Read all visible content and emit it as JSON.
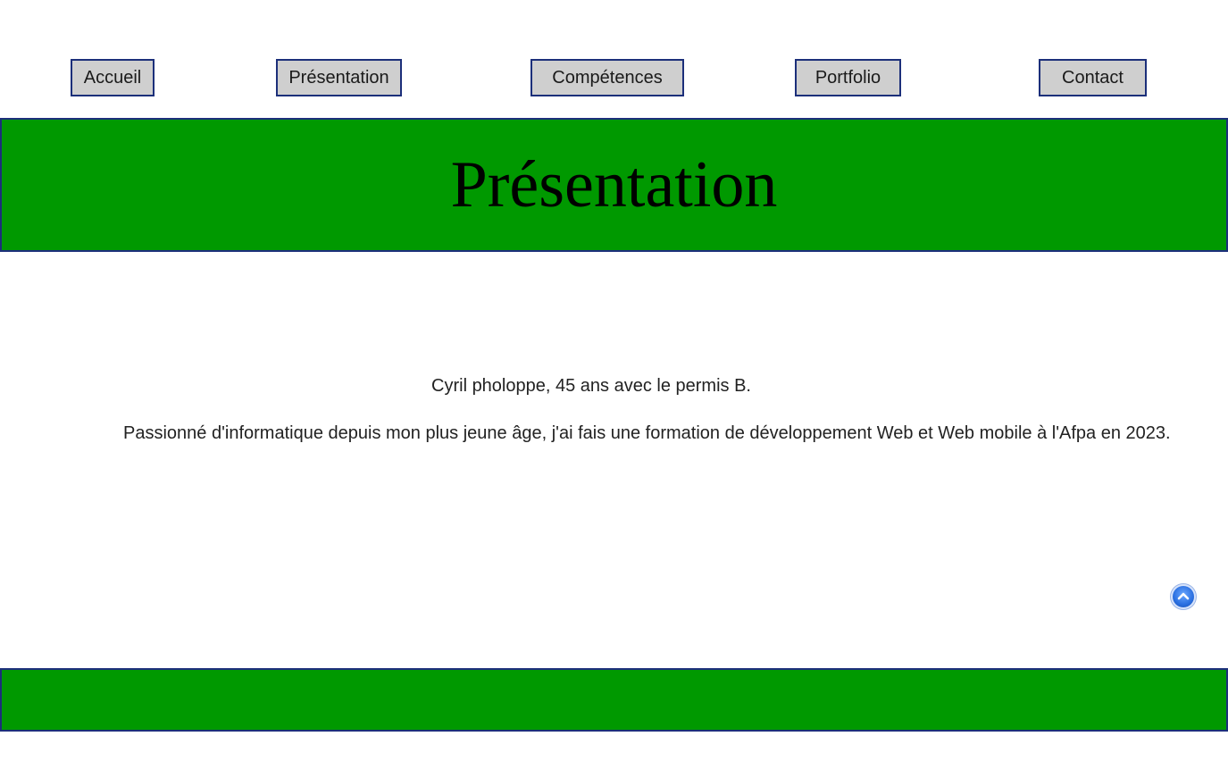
{
  "nav": {
    "items": [
      {
        "label": "Accueil"
      },
      {
        "label": "Présentation"
      },
      {
        "label": "Compétences"
      },
      {
        "label": "Portfolio"
      },
      {
        "label": "Contact"
      }
    ]
  },
  "header": {
    "title": "Présentation"
  },
  "main": {
    "line1": "Cyril pholoppe, 45 ans avec le permis B.",
    "line2": "Passionné d'informatique depuis mon plus jeune âge, j'ai fais une formation de développement Web et Web mobile à l'Afpa en 2023."
  },
  "scroll_top": {
    "icon": "chevron-up-icon"
  },
  "colors": {
    "banner": "#009900",
    "border": "#1c2f7a",
    "button_bg": "#cfcfcf",
    "scroll_button": "#2a6fe0"
  }
}
